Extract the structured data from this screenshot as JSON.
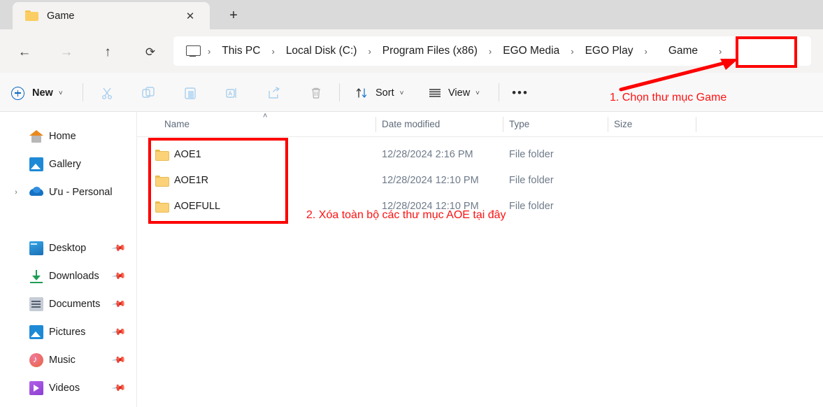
{
  "window": {
    "tab": {
      "label": "Game",
      "icon": "folder-icon",
      "close_label": "✕"
    },
    "new_tab_label": "+"
  },
  "navigation": {
    "back": "←",
    "forward": "→",
    "up": "↑",
    "refresh": "⟳"
  },
  "breadcrumb": {
    "root_icon": "this-pc-icon",
    "separator": "›",
    "items": [
      {
        "label": "This PC"
      },
      {
        "label": "Local Disk (C:)"
      },
      {
        "label": "Program Files (x86)"
      },
      {
        "label": "EGO Media"
      },
      {
        "label": "EGO Play"
      },
      {
        "label": "Game"
      }
    ]
  },
  "toolbar": {
    "new_label": "New",
    "chevron": "˅",
    "cut_label": "Cut",
    "copy_label": "Copy",
    "paste_label": "Paste",
    "rename_label": "Rename",
    "share_label": "Share",
    "delete_label": "Delete",
    "sort_label": "Sort",
    "view_label": "View",
    "more_label": "•••"
  },
  "sidebar": {
    "items": [
      {
        "label": "Home",
        "icon": "home-icon",
        "pinned": false,
        "expandable": false
      },
      {
        "label": "Gallery",
        "icon": "gallery-icon",
        "pinned": false,
        "expandable": false
      },
      {
        "label": "Ưu - Personal",
        "icon": "onedrive-cloud-icon",
        "pinned": false,
        "expandable": true
      },
      {
        "label": "Desktop",
        "icon": "desktop-icon",
        "pinned": true,
        "expandable": false
      },
      {
        "label": "Downloads",
        "icon": "downloads-icon",
        "pinned": true,
        "expandable": false
      },
      {
        "label": "Documents",
        "icon": "documents-icon",
        "pinned": true,
        "expandable": false
      },
      {
        "label": "Pictures",
        "icon": "pictures-icon",
        "pinned": true,
        "expandable": false
      },
      {
        "label": "Music",
        "icon": "music-icon",
        "pinned": true,
        "expandable": false
      },
      {
        "label": "Videos",
        "icon": "videos-icon",
        "pinned": true,
        "expandable": false
      }
    ],
    "pin_glyph": "📌"
  },
  "file_list": {
    "columns": [
      {
        "label": "Name"
      },
      {
        "label": "Date modified"
      },
      {
        "label": "Type"
      },
      {
        "label": "Size"
      }
    ],
    "sort_indicator": "˄",
    "rows": [
      {
        "name": "AOE1",
        "date_modified": "12/28/2024 2:16 PM",
        "type": "File folder",
        "size": ""
      },
      {
        "name": "AOE1R",
        "date_modified": "12/28/2024 12:10 PM",
        "type": "File folder",
        "size": ""
      },
      {
        "name": "AOEFULL",
        "date_modified": "12/28/2024 12:10 PM",
        "type": "File folder",
        "size": ""
      }
    ]
  },
  "annotations": {
    "step1": "1. Chọn thư mục Game",
    "step2": "2. Xóa toàn bộ các thư mục AOE tại đây",
    "color": "#fd0000"
  }
}
